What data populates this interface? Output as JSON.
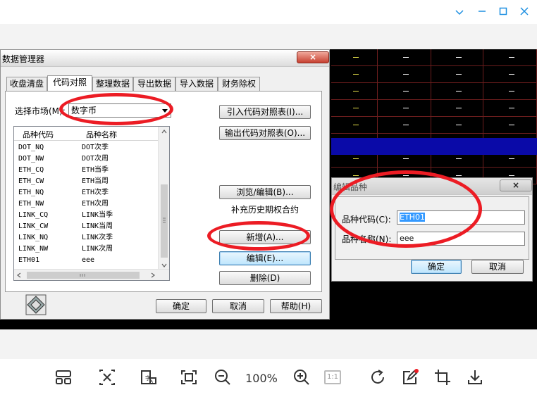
{
  "viewer": {
    "zoom_label": "100%",
    "one_to_one_label": "1:1",
    "window_controls": [
      "chevron-down-icon",
      "minimize-icon",
      "maximize-icon",
      "close-icon"
    ],
    "toolbar_icons": [
      "thumbnail-view-icon",
      "shuffle-icon",
      "image-text-icon",
      "fit-window-icon",
      "zoom-out-icon",
      "zoom-in-icon",
      "one-to-one-icon",
      "rotate-icon",
      "edit-icon",
      "crop-icon",
      "download-icon"
    ]
  },
  "main_dialog": {
    "title": "数据管理器",
    "close_label": "×",
    "tabs": [
      "收盘清盘",
      "代码对照",
      "整理数据",
      "导出数据",
      "导入数据",
      "财务除权"
    ],
    "market_label": "选择市场(M):",
    "market_value": "数字币",
    "list_columns": [
      "品种代码",
      "品种名称"
    ],
    "list_rows": [
      [
        "DOT_NQ",
        "DOT次季"
      ],
      [
        "DOT_NW",
        "DOT次周"
      ],
      [
        "ETH_CQ",
        "ETH当季"
      ],
      [
        "ETH_CW",
        "ETH当周"
      ],
      [
        "ETH_NQ",
        "ETH次季"
      ],
      [
        "ETH_NW",
        "ETH次周"
      ],
      [
        "LINK_CQ",
        "LINK当季"
      ],
      [
        "LINK_CW",
        "LINK当周"
      ],
      [
        "LINK_NQ",
        "LINK次季"
      ],
      [
        "LINK_NW",
        "LINK次周"
      ],
      [
        "ETH01",
        "eee"
      ]
    ],
    "side_buttons": {
      "import": "引入代码对照表(I)...",
      "export": "输出代码对照表(O)...",
      "browse": "浏览/编辑(B)...",
      "supplement": "补充历史期权合约",
      "add": "新增(A)...",
      "edit": "编辑(E)...",
      "delete": "删除(D)"
    },
    "footer_buttons": {
      "ok": "确定",
      "cancel": "取消",
      "help": "帮助(H)"
    }
  },
  "edit_dialog": {
    "title": "编辑品种",
    "close_label": "×",
    "code_label": "品种代码(C):",
    "code_value": "ETH01",
    "name_label": "品种名称(N):",
    "name_value": "eee",
    "ok": "确定",
    "cancel": "取消"
  },
  "colors": {
    "annotation": "#ec1c24",
    "accent": "#1d8fe1",
    "selected_row": "#0a0aa8",
    "grid_line": "#6b1d1d"
  }
}
